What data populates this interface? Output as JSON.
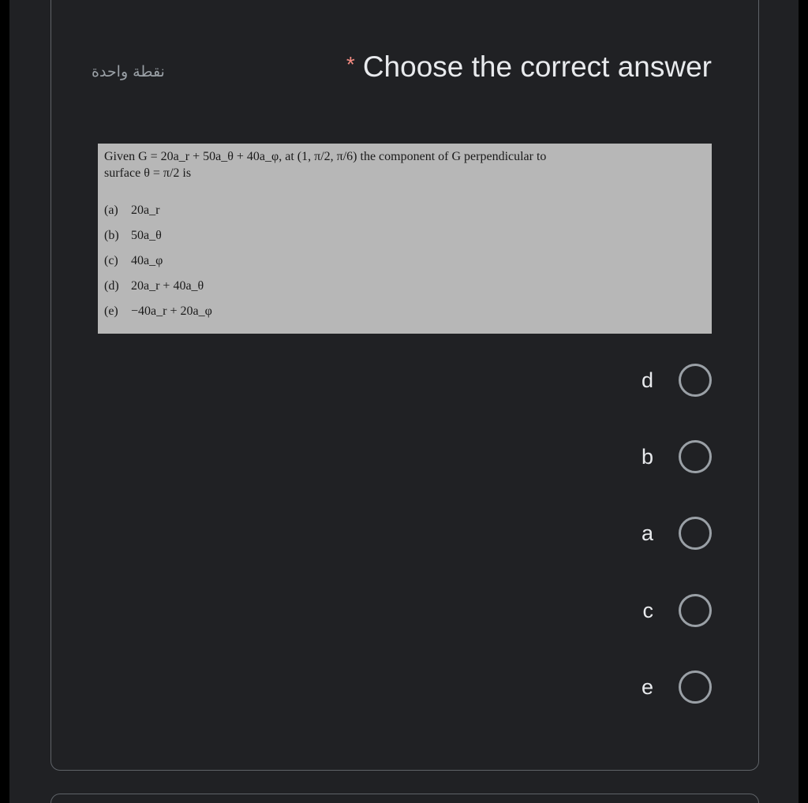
{
  "points_label": "نقطة واحدة",
  "question": {
    "required_marker": "*",
    "title": "Choose the correct answer"
  },
  "question_image": {
    "stem_1": "Given G = 20a_r + 50a_θ + 40a_φ, at (1, π/2, π/6) the component of G perpendicular to",
    "stem_2": "surface θ = π/2 is",
    "options": [
      {
        "label": "(a)",
        "text": "20a_r"
      },
      {
        "label": "(b)",
        "text": "50a_θ"
      },
      {
        "label": "(c)",
        "text": "40a_φ"
      },
      {
        "label": "(d)",
        "text": "20a_r + 40a_θ"
      },
      {
        "label": "(e)",
        "text": "−40a_r + 20a_φ"
      }
    ]
  },
  "choices": [
    {
      "label": "d"
    },
    {
      "label": "b"
    },
    {
      "label": "a"
    },
    {
      "label": "c"
    },
    {
      "label": "e"
    }
  ],
  "colors": {
    "background": "#202124",
    "card_border": "#5f6368",
    "text": "#e8eaed",
    "muted": "#9aa0a6",
    "required": "#f28b82",
    "image_bg": "#b7b7b7"
  }
}
